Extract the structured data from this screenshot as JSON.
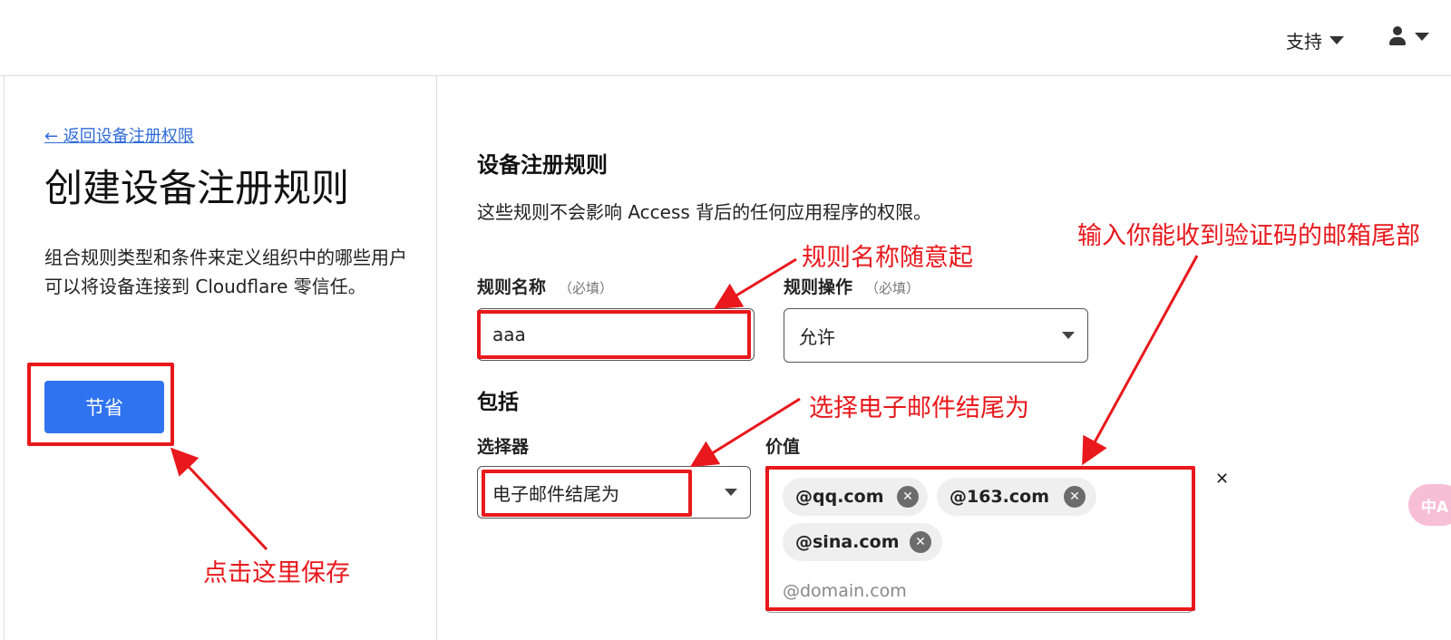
{
  "topbar": {
    "support_label": "支持"
  },
  "left": {
    "back_link": "← 返回设备注册权限",
    "title": "创建设备注册规则",
    "description": "组合规则类型和条件来定义组织中的哪些用户可以将设备连接到 Cloudflare 零信任。",
    "save_label": "节省"
  },
  "form": {
    "section_title": "设备注册规则",
    "section_desc": "这些规则不会影响 Access 背后的任何应用程序的权限。",
    "rule_name_label": "规则名称",
    "required_hint": "（必填）",
    "rule_name_value": "aaa",
    "rule_action_label": "规则操作",
    "rule_action_value": "允许",
    "include_title": "包括",
    "selector_label": "选择器",
    "selector_value": "电子邮件结尾为",
    "value_label": "价值",
    "chips": [
      "@qq.com",
      "@163.com",
      "@sina.com"
    ],
    "value_placeholder": "@domain.com"
  },
  "fab": {
    "label": "中A"
  },
  "annotations": {
    "rule_name_note": "规则名称随意起",
    "selector_note": "选择电子邮件结尾为",
    "value_note": "输入你能收到验证码的邮箱尾部",
    "save_note": "点击这里保存"
  },
  "colors": {
    "accent": "#2f73f0",
    "annotation": "#e8181c",
    "link": "#2f6bd8"
  }
}
